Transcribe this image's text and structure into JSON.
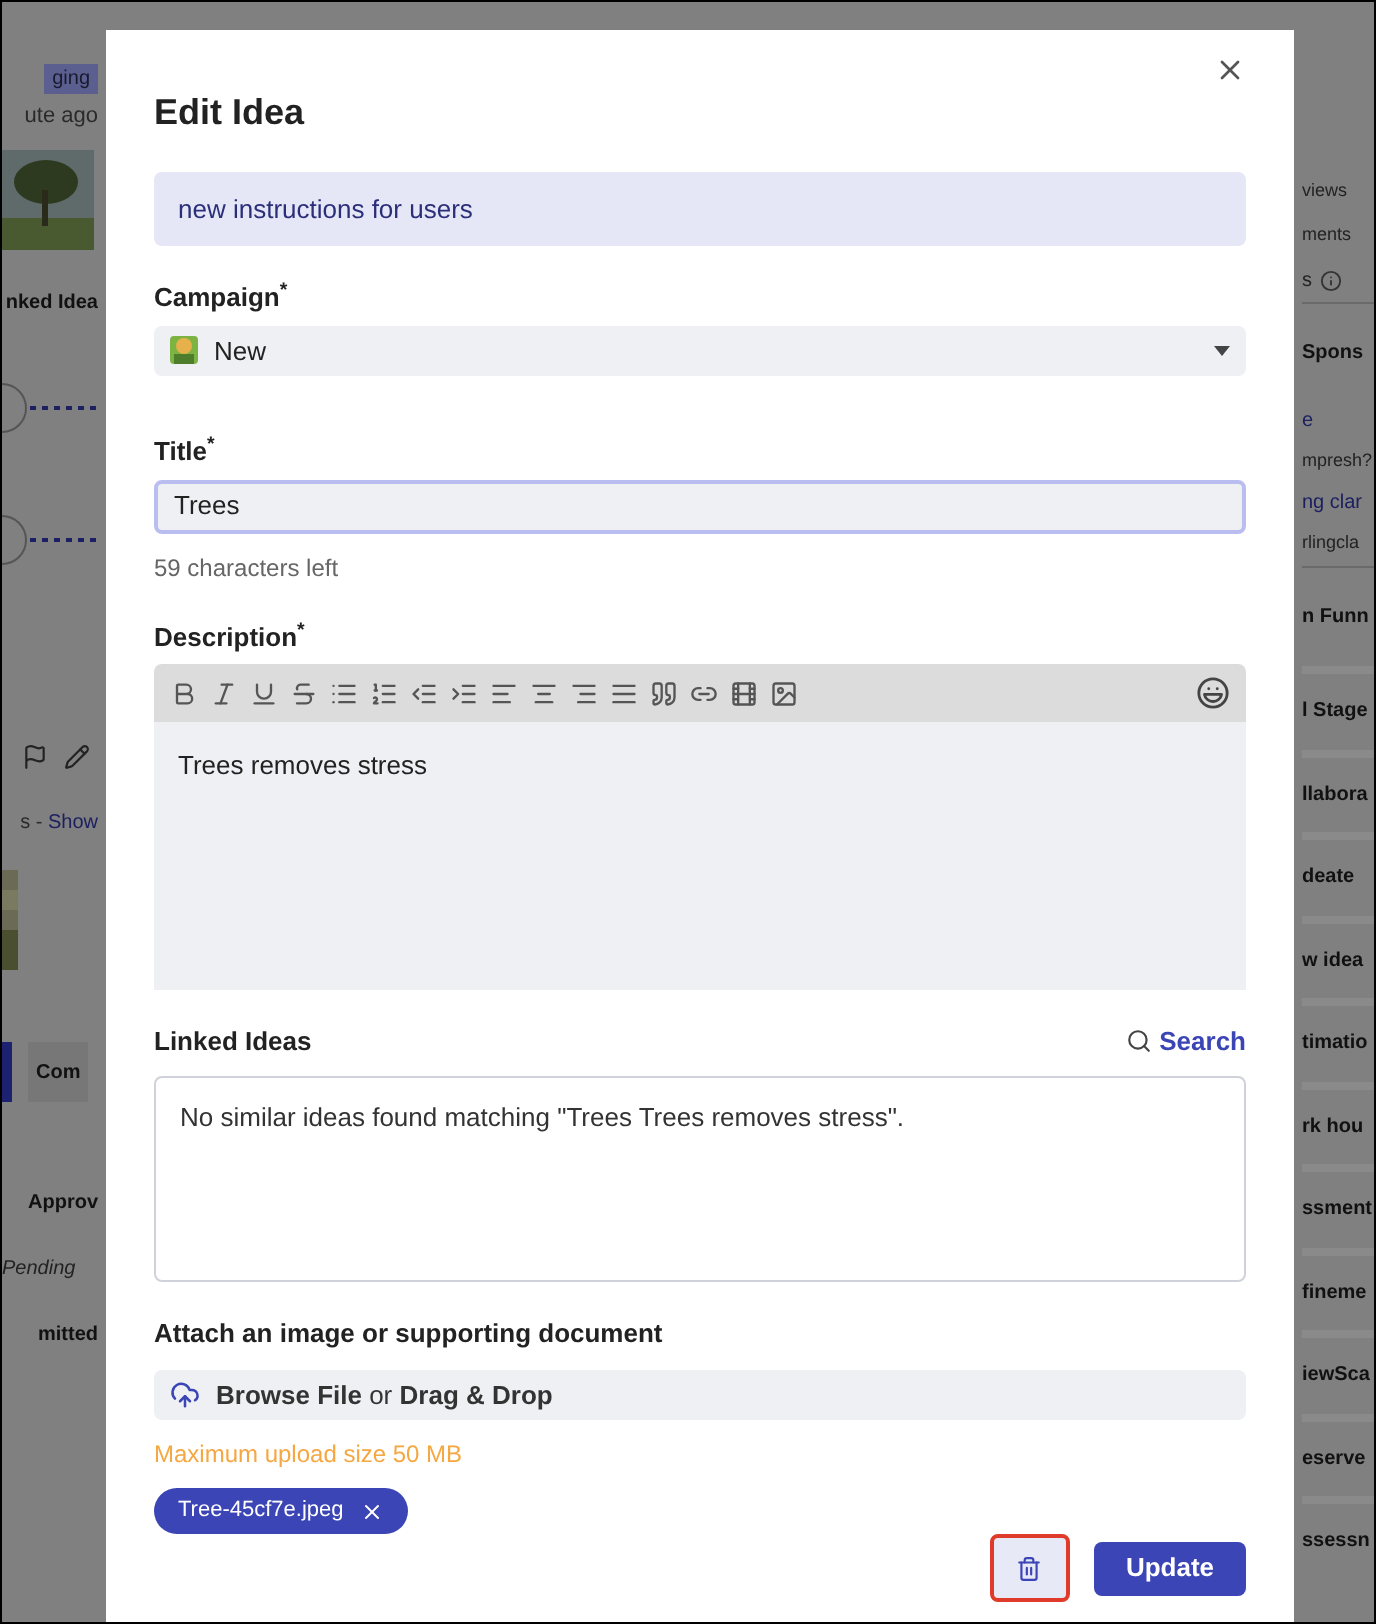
{
  "background_left": [
    {
      "kind": "badge",
      "text": "ging"
    },
    {
      "kind": "muted",
      "text": "ute ago"
    },
    {
      "kind": "picture"
    },
    {
      "kind": "heading",
      "text": "nked Idea"
    },
    {
      "kind": "connector"
    },
    {
      "kind": "connector"
    },
    {
      "kind": "actions"
    },
    {
      "kind": "link_line",
      "text": "s - ",
      "link": "Show"
    },
    {
      "kind": "thumbnail"
    },
    {
      "kind": "button",
      "text": "Com"
    },
    {
      "kind": "heading",
      "text": "Approv"
    },
    {
      "kind": "italic",
      "text": "Pending"
    },
    {
      "kind": "heading",
      "text": "mitted"
    }
  ],
  "background_right": [
    {
      "kind": "muted",
      "text": "views"
    },
    {
      "kind": "muted",
      "text": "ments"
    },
    {
      "kind": "info",
      "text": "s"
    },
    {
      "kind": "heading",
      "text": "Spons"
    },
    {
      "kind": "link",
      "text": "e"
    },
    {
      "kind": "muted",
      "text": "mpresh?"
    },
    {
      "kind": "link",
      "text": "ng clar"
    },
    {
      "kind": "muted",
      "text": "rlingcla"
    },
    {
      "kind": "heading",
      "text": "n Funn"
    },
    {
      "kind": "stage",
      "text": "l Stage"
    },
    {
      "kind": "stage",
      "text": "llabora"
    },
    {
      "kind": "stage",
      "text": "deate"
    },
    {
      "kind": "stage",
      "text": "w idea"
    },
    {
      "kind": "stage",
      "text": "timatio"
    },
    {
      "kind": "stage",
      "text": "rk hou"
    },
    {
      "kind": "stage",
      "text": "ssment"
    },
    {
      "kind": "stage",
      "text": "fineme"
    },
    {
      "kind": "stage",
      "text": "iewSca"
    },
    {
      "kind": "stage",
      "text": "eserve"
    },
    {
      "kind": "stage",
      "text": "ssessn"
    }
  ],
  "modal": {
    "title": "Edit Idea",
    "notice": "new instructions for users",
    "campaign": {
      "label": "Campaign$^{*}$",
      "value": "New"
    },
    "title_field": {
      "label": "Title$^{*}$",
      "value": "Trees",
      "focused": true,
      "hint": "59 characters left"
    },
    "description": {
      "label": "Description$^{*}$",
      "value": "Trees removes stress"
    },
    "linked_ideas": {
      "label": "Linked Ideas",
      "search": "Search",
      "message": "No similar ideas found matching \"Trees Trees removes stress\"."
    },
    "attachment": {
      "label": "Attach an image or supporting document",
      "browse": "**Browse File** or **Drag & Drop**",
      "limit": "Maximum upload size 50 MB",
      "files": [
        "Tree-45cf7e.jpeg"
      ]
    },
    "delete_button": {
      "highlighted": true
    },
    "update_button": "Update"
  }
}
